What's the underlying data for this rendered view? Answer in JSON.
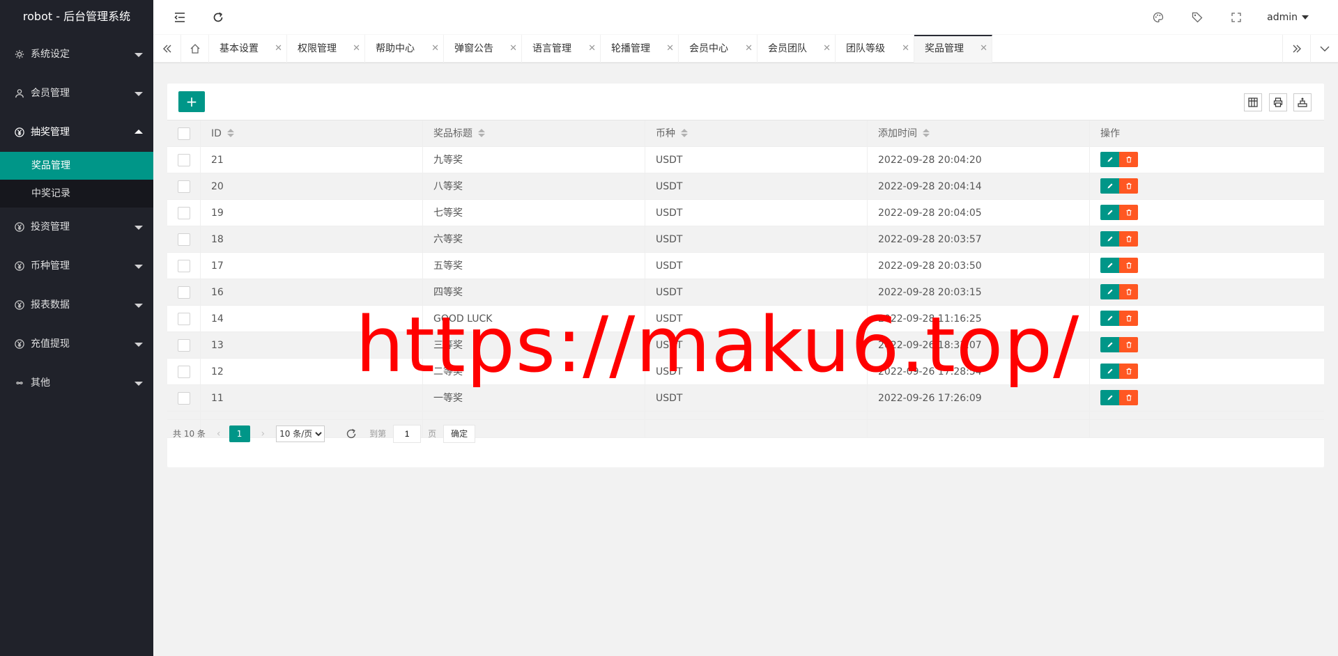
{
  "app": {
    "title": "robot - 后台管理系统"
  },
  "sidebar": {
    "items": [
      {
        "label": "系统设定",
        "icon": "gear-icon"
      },
      {
        "label": "会员管理",
        "icon": "user-icon"
      },
      {
        "label": "抽奖管理",
        "icon": "yen-icon",
        "open": true,
        "children": [
          {
            "label": "奖品管理",
            "active": true
          },
          {
            "label": "中奖记录"
          }
        ]
      },
      {
        "label": "投资管理",
        "icon": "yen-icon"
      },
      {
        "label": "币种管理",
        "icon": "yen-icon"
      },
      {
        "label": "报表数据",
        "icon": "yen-icon"
      },
      {
        "label": "充值提现",
        "icon": "yen-icon"
      },
      {
        "label": "其他",
        "icon": "infinity-icon"
      }
    ]
  },
  "header": {
    "user": "admin"
  },
  "tabs": [
    "基本设置",
    "权限管理",
    "帮助中心",
    "弹窗公告",
    "语言管理",
    "轮播管理",
    "会员中心",
    "会员团队",
    "团队等级",
    "奖品管理"
  ],
  "table": {
    "columns": [
      "ID",
      "奖品标题",
      "币种",
      "添加时间",
      "操作"
    ],
    "rows": [
      {
        "id": "21",
        "title": "九等奖",
        "coin": "USDT",
        "time": "2022-09-28 20:04:20"
      },
      {
        "id": "20",
        "title": "八等奖",
        "coin": "USDT",
        "time": "2022-09-28 20:04:14"
      },
      {
        "id": "19",
        "title": "七等奖",
        "coin": "USDT",
        "time": "2022-09-28 20:04:05"
      },
      {
        "id": "18",
        "title": "六等奖",
        "coin": "USDT",
        "time": "2022-09-28 20:03:57"
      },
      {
        "id": "17",
        "title": "五等奖",
        "coin": "USDT",
        "time": "2022-09-28 20:03:50"
      },
      {
        "id": "16",
        "title": "四等奖",
        "coin": "USDT",
        "time": "2022-09-28 20:03:15"
      },
      {
        "id": "14",
        "title": "GOOD LUCK",
        "coin": "USDT",
        "time": "2022-09-28 11:16:25"
      },
      {
        "id": "13",
        "title": "三等奖",
        "coin": "USDT",
        "time": "2022-09-26 18:33:07"
      },
      {
        "id": "12",
        "title": "二等奖",
        "coin": "USDT",
        "time": "2022-09-26 17:28:54"
      },
      {
        "id": "11",
        "title": "一等奖",
        "coin": "USDT",
        "time": "2022-09-26 17:26:09"
      }
    ]
  },
  "pager": {
    "total": "共 10 条",
    "page": "1",
    "limit": "10 条/页",
    "skip_label": "到第",
    "skip_value": "1",
    "page_label": "页",
    "ok": "确定"
  },
  "watermark": "https://maku6.top/",
  "colors": {
    "sidebar": "#20222a",
    "accent": "#009688",
    "danger": "#ff5722",
    "watermark": "#ff0000"
  }
}
